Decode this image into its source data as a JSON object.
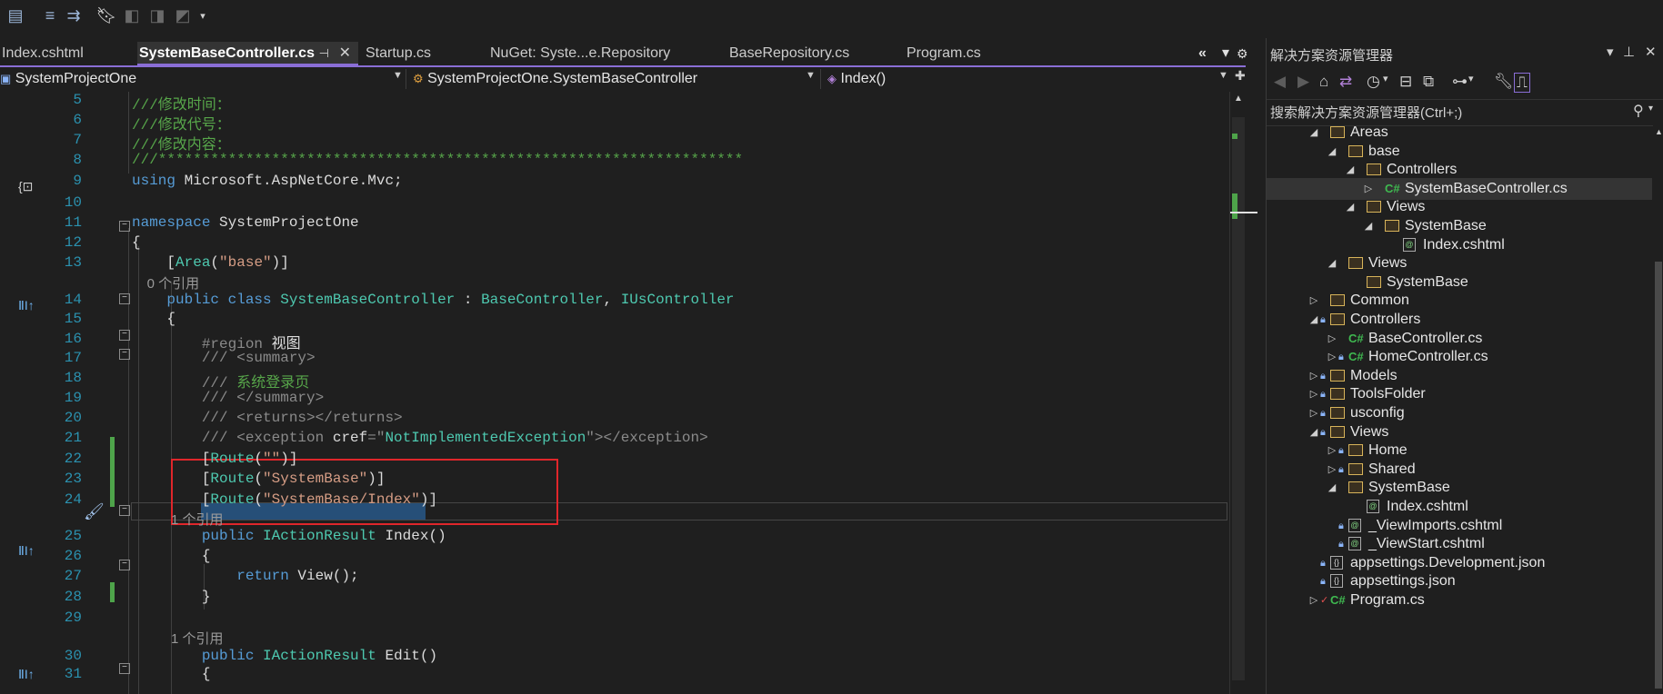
{
  "toolbar": {
    "icons": [
      "format-icon",
      "indent-icon",
      "outdent-icon",
      "bookmark-icon",
      "bookmark-prev-icon",
      "bookmark-next-icon",
      "bookmark-clear-icon",
      "dropdown-icon"
    ]
  },
  "tabs": [
    {
      "label": "Index.cshtml"
    },
    {
      "label": "SystemBaseController.cs",
      "active": true
    },
    {
      "label": "Startup.cs"
    },
    {
      "label": "NuGet: Syste...e.Repository"
    },
    {
      "label": "BaseRepository.cs"
    },
    {
      "label": "Program.cs"
    }
  ],
  "tab_controls": {
    "close": "✕",
    "pin": "⊣",
    "overflow": "«",
    "menu": "▾",
    "settings": "⚙"
  },
  "navbar": {
    "project": "SystemProjectOne",
    "class": "SystemProjectOne.SystemBaseController",
    "member": "Index()"
  },
  "code": {
    "lines": [
      {
        "n": "5",
        "parts": [
          [
            "cm",
            "///修改时间："
          ]
        ]
      },
      {
        "n": "6",
        "parts": [
          [
            "cm",
            "///修改代号："
          ]
        ]
      },
      {
        "n": "7",
        "parts": [
          [
            "cm",
            "///修改内容："
          ]
        ]
      },
      {
        "n": "8",
        "parts": [
          [
            "cm",
            "///*******************************************************************"
          ]
        ]
      },
      {
        "n": "9",
        "parts": [
          [
            "kw",
            "using"
          ],
          [
            "plain",
            " Microsoft.AspNetCore.Mvc;"
          ]
        ]
      },
      {
        "n": "10",
        "parts": []
      },
      {
        "n": "11",
        "parts": [
          [
            "kw",
            "namespace"
          ],
          [
            "plain",
            " SystemProjectOne"
          ]
        ]
      },
      {
        "n": "12",
        "parts": [
          [
            "plain",
            "{"
          ]
        ]
      },
      {
        "n": "13",
        "parts": [
          [
            "plain",
            "    ["
          ],
          [
            "ty",
            "Area"
          ],
          [
            "plain",
            "("
          ],
          [
            "st",
            "\"base\""
          ],
          [
            "plain",
            ")]"
          ]
        ]
      },
      {
        "n": "",
        "ref": "0 个引用"
      },
      {
        "n": "14",
        "parts": [
          [
            "plain",
            "    "
          ],
          [
            "kw",
            "public class"
          ],
          [
            "plain",
            " "
          ],
          [
            "ty",
            "SystemBaseController"
          ],
          [
            "plain",
            " : "
          ],
          [
            "ty",
            "BaseController"
          ],
          [
            "plain",
            ", "
          ],
          [
            "ty",
            "IUsController"
          ]
        ]
      },
      {
        "n": "15",
        "parts": [
          [
            "plain",
            "    {"
          ]
        ]
      },
      {
        "n": "16",
        "parts": [
          [
            "plain",
            "        "
          ],
          [
            "cx",
            "#region"
          ],
          [
            "plain",
            " 视图"
          ]
        ]
      },
      {
        "n": "17",
        "parts": [
          [
            "plain",
            "        "
          ],
          [
            "cx",
            "/// <summary>"
          ]
        ]
      },
      {
        "n": "18",
        "parts": [
          [
            "plain",
            "        "
          ],
          [
            "cx",
            "/// "
          ],
          [
            "cm",
            "系统登录页"
          ]
        ]
      },
      {
        "n": "19",
        "parts": [
          [
            "plain",
            "        "
          ],
          [
            "cx",
            "/// </summary>"
          ]
        ]
      },
      {
        "n": "20",
        "parts": [
          [
            "plain",
            "        "
          ],
          [
            "cx",
            "/// <returns></returns>"
          ]
        ]
      },
      {
        "n": "21",
        "parts": [
          [
            "plain",
            "        "
          ],
          [
            "cx",
            "/// <exception "
          ],
          [
            "plain",
            "cref"
          ],
          [
            "cx",
            "=\""
          ],
          [
            "ty",
            "NotImplementedException"
          ],
          [
            "cx",
            "\"></exception>"
          ]
        ]
      },
      {
        "n": "22",
        "parts": [
          [
            "plain",
            "        ["
          ],
          [
            "ty",
            "Route"
          ],
          [
            "plain",
            "("
          ],
          [
            "st",
            "\"\""
          ],
          [
            "plain",
            ")]"
          ]
        ]
      },
      {
        "n": "23",
        "parts": [
          [
            "plain",
            "        ["
          ],
          [
            "ty",
            "Route"
          ],
          [
            "plain",
            "("
          ],
          [
            "st",
            "\"SystemBase\""
          ],
          [
            "plain",
            ")]"
          ]
        ]
      },
      {
        "n": "24",
        "parts": [
          [
            "plain",
            "        ["
          ],
          [
            "ty",
            "Route"
          ],
          [
            "plain",
            "("
          ],
          [
            "st",
            "\"SystemBase/Index\""
          ],
          [
            "plain",
            ")]"
          ]
        ]
      },
      {
        "n": "",
        "ref": "1 个引用"
      },
      {
        "n": "25",
        "parts": [
          [
            "plain",
            "        "
          ],
          [
            "kw",
            "public"
          ],
          [
            "plain",
            " "
          ],
          [
            "ty",
            "IActionResult"
          ],
          [
            "plain",
            " Index()"
          ]
        ]
      },
      {
        "n": "26",
        "parts": [
          [
            "plain",
            "        {"
          ]
        ]
      },
      {
        "n": "27",
        "parts": [
          [
            "plain",
            "            "
          ],
          [
            "kw",
            "return"
          ],
          [
            "plain",
            " View();"
          ]
        ]
      },
      {
        "n": "28",
        "parts": [
          [
            "plain",
            "        }"
          ]
        ]
      },
      {
        "n": "29",
        "parts": []
      },
      {
        "n": "",
        "ref": "1 个引用"
      },
      {
        "n": "30",
        "parts": [
          [
            "plain",
            "        "
          ],
          [
            "kw",
            "public"
          ],
          [
            "plain",
            " "
          ],
          [
            "ty",
            "IActionResult"
          ],
          [
            "plain",
            " Edit()"
          ]
        ]
      },
      {
        "n": "31",
        "parts": [
          [
            "plain",
            "        {"
          ]
        ]
      }
    ]
  },
  "solution_explorer": {
    "title": "解决方案资源管理器",
    "search_placeholder": "搜索解决方案资源管理器(Ctrl+;)",
    "items": [
      {
        "label": "Areas",
        "kind": "folder",
        "depth": 2,
        "state": "open"
      },
      {
        "label": "base",
        "kind": "folder",
        "depth": 3,
        "state": "open"
      },
      {
        "label": "Controllers",
        "kind": "folder",
        "depth": 4,
        "state": "open"
      },
      {
        "label": "SystemBaseController.cs",
        "kind": "cs",
        "depth": 5,
        "state": "closed",
        "selected": true
      },
      {
        "label": "Views",
        "kind": "folder",
        "depth": 4,
        "state": "open"
      },
      {
        "label": "SystemBase",
        "kind": "folder",
        "depth": 5,
        "state": "open"
      },
      {
        "label": "Index.cshtml",
        "kind": "razor",
        "depth": 6,
        "state": "none"
      },
      {
        "label": "Views",
        "kind": "folder",
        "depth": 3,
        "state": "open"
      },
      {
        "label": "SystemBase",
        "kind": "folder",
        "depth": 4,
        "state": "none"
      },
      {
        "label": "Common",
        "kind": "folder",
        "depth": 2,
        "state": "closed"
      },
      {
        "label": "Controllers",
        "kind": "folder",
        "depth": 2,
        "state": "open",
        "locked": true
      },
      {
        "label": "BaseController.cs",
        "kind": "cs",
        "depth": 3,
        "state": "closed"
      },
      {
        "label": "HomeController.cs",
        "kind": "cs",
        "depth": 3,
        "state": "closed",
        "locked": true
      },
      {
        "label": "Models",
        "kind": "folder",
        "depth": 2,
        "state": "closed",
        "locked": true
      },
      {
        "label": "ToolsFolder",
        "kind": "folder",
        "depth": 2,
        "state": "closed",
        "locked": true
      },
      {
        "label": "usconfig",
        "kind": "folder",
        "depth": 2,
        "state": "closed",
        "locked": true
      },
      {
        "label": "Views",
        "kind": "folder",
        "depth": 2,
        "state": "open",
        "locked": true
      },
      {
        "label": "Home",
        "kind": "folder",
        "depth": 3,
        "state": "closed",
        "locked": true
      },
      {
        "label": "Shared",
        "kind": "folder",
        "depth": 3,
        "state": "closed",
        "locked": true
      },
      {
        "label": "SystemBase",
        "kind": "folder",
        "depth": 3,
        "state": "open"
      },
      {
        "label": "Index.cshtml",
        "kind": "razor",
        "depth": 4,
        "state": "none"
      },
      {
        "label": "_ViewImports.cshtml",
        "kind": "razor",
        "depth": 3,
        "state": "none",
        "locked": true
      },
      {
        "label": "_ViewStart.cshtml",
        "kind": "razor",
        "depth": 3,
        "state": "none",
        "locked": true
      },
      {
        "label": "appsettings.Development.json",
        "kind": "json",
        "depth": 2,
        "state": "none",
        "locked": true
      },
      {
        "label": "appsettings.json",
        "kind": "json",
        "depth": 2,
        "state": "none",
        "locked": true
      },
      {
        "label": "Program.cs",
        "kind": "cs",
        "depth": 2,
        "state": "closed",
        "checked": true
      }
    ]
  },
  "colors": {
    "accent": "#8a6ed6",
    "highlight_box": "#e0262b",
    "change_bar": "#4ea44a"
  }
}
